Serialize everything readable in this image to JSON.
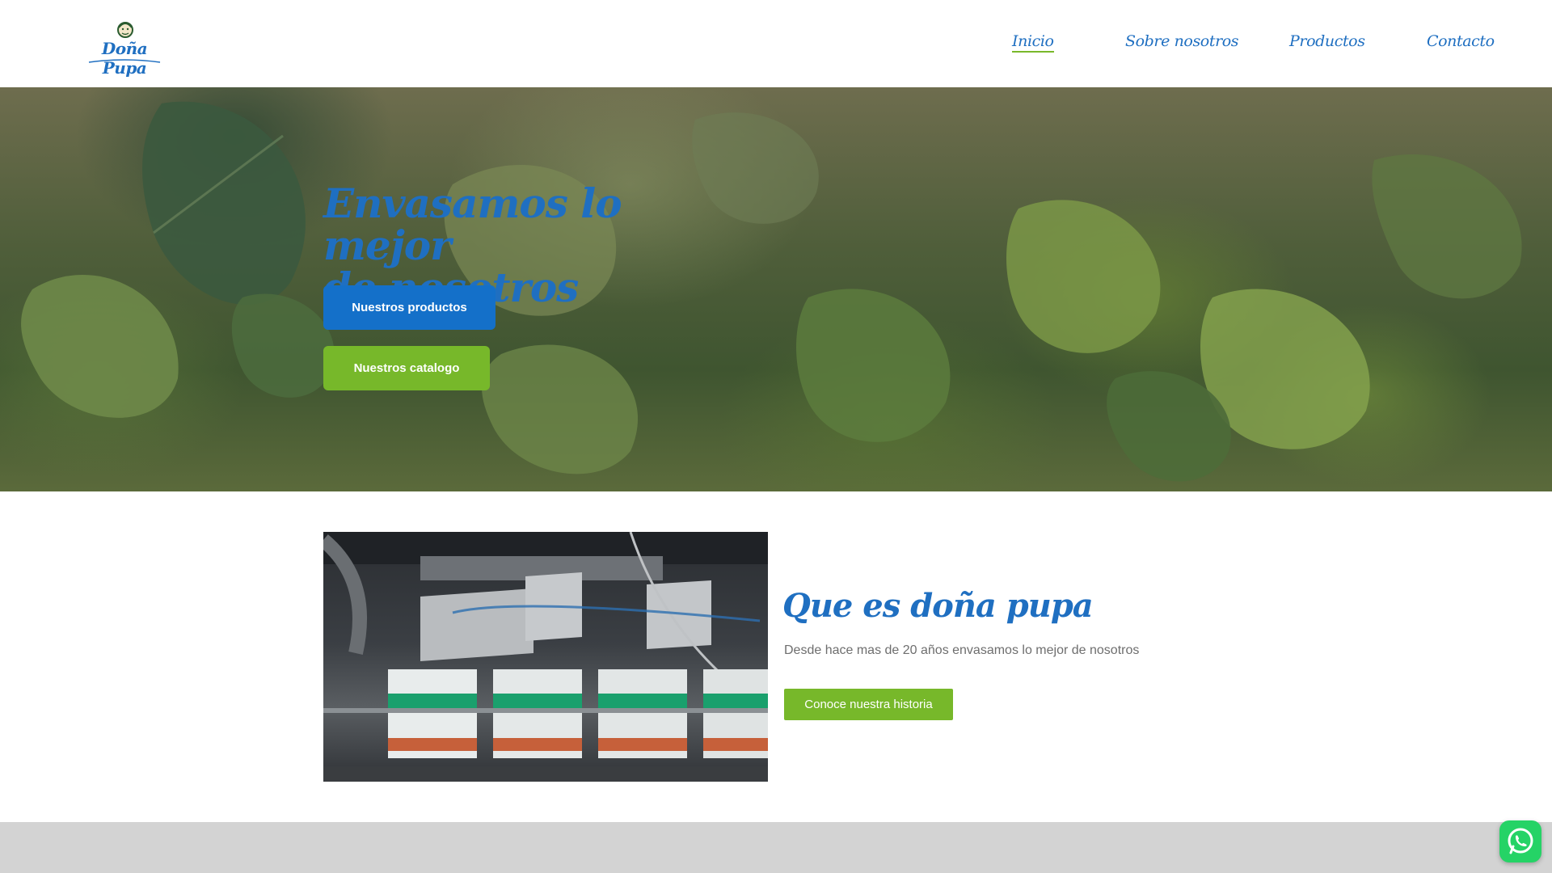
{
  "header": {
    "logo_text": "Doña Pupa",
    "nav": [
      {
        "label": "Inicio",
        "active": true
      },
      {
        "label": "Sobre nosotros",
        "active": false
      },
      {
        "label": "Productos",
        "active": false
      },
      {
        "label": "Contacto",
        "active": false
      }
    ]
  },
  "hero": {
    "title_line1": "Envasamos lo mejor",
    "title_line2": "de nosotros",
    "btn_products": "Nuestros productos",
    "btn_catalog": "Nuestros catalogo"
  },
  "about": {
    "title": "Que es doña pupa",
    "text": "Desde hace mas de 20 años envasamos lo mejor de nosotros",
    "btn_history": "Conoce nuestra historia"
  },
  "icons": {
    "whatsapp": "whatsapp-icon"
  },
  "colors": {
    "brand_blue": "#1f6fc1",
    "button_blue": "#1470c9",
    "accent_green": "#77b82a",
    "band_gray": "#d3d3d3"
  }
}
